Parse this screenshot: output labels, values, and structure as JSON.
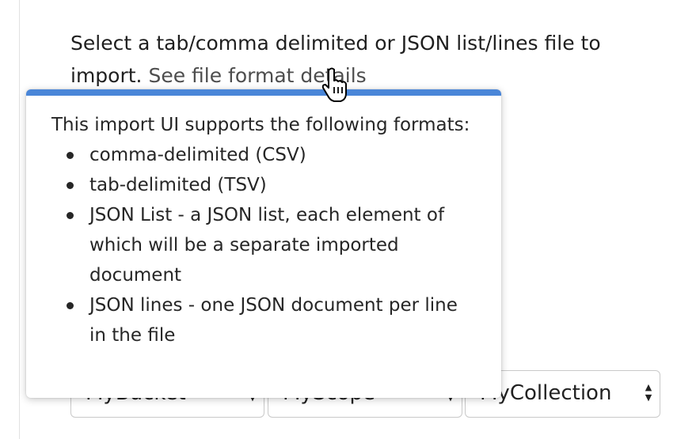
{
  "intro": {
    "text": "Select a tab/comma delimited or JSON list/lines file to import.",
    "link_text": "See file format details"
  },
  "tooltip": {
    "heading": "This import UI supports the following formats:",
    "items": [
      "comma-delimited (CSV)",
      "tab-delimited (TSV)",
      "JSON List - a JSON list, each element of which will be a separate imported document",
      "JSON lines - one JSON document per line in the file"
    ],
    "accent_color": "#4a86d8"
  },
  "selects": {
    "bucket": "MyBucket",
    "scope": "MyScope",
    "collection": "MyCollection"
  },
  "icons": {
    "cursor": "hand-pointer-icon",
    "select_arrows": "up-down-arrows-icon"
  }
}
